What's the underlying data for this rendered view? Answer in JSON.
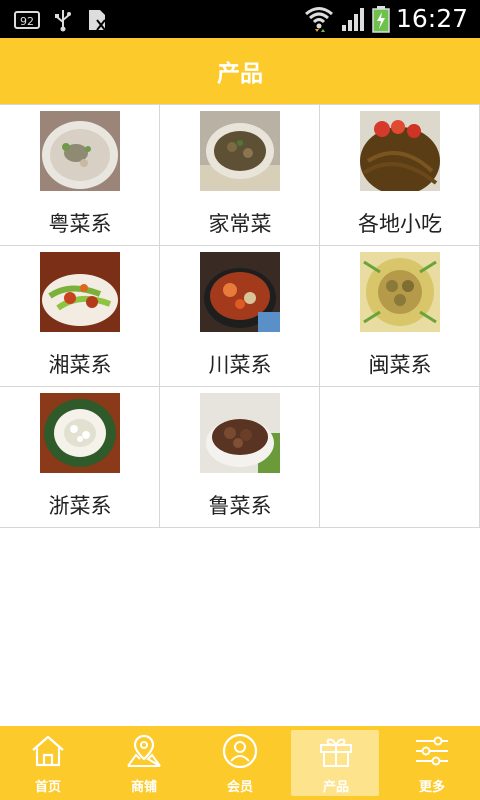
{
  "status_bar": {
    "time": "16:27",
    "icons": [
      "notification-92-icon",
      "usb-icon",
      "sim-icon",
      "wifi-icon",
      "signal-icon",
      "battery-charging-icon"
    ],
    "notification_number": "92"
  },
  "header": {
    "title": "产品"
  },
  "products": [
    {
      "label": "粤菜系",
      "icon": "cantonese-dish-photo"
    },
    {
      "label": "家常菜",
      "icon": "home-style-dish-photo"
    },
    {
      "label": "各地小吃",
      "icon": "local-snacks-photo"
    },
    {
      "label": "湘菜系",
      "icon": "hunan-dish-photo"
    },
    {
      "label": "川菜系",
      "icon": "sichuan-dish-photo"
    },
    {
      "label": "闽菜系",
      "icon": "fujian-dish-photo"
    },
    {
      "label": "浙菜系",
      "icon": "zhejiang-dish-photo"
    },
    {
      "label": "鲁菜系",
      "icon": "shandong-dish-photo"
    }
  ],
  "tab_bar": {
    "items": [
      {
        "label": "首页",
        "icon": "home-icon"
      },
      {
        "label": "商铺",
        "icon": "map-store-icon"
      },
      {
        "label": "会员",
        "icon": "member-icon"
      },
      {
        "label": "产品",
        "icon": "gift-icon",
        "active": true
      },
      {
        "label": "更多",
        "icon": "settings-sliders-icon"
      }
    ]
  },
  "colors": {
    "accent": "#fcca2b",
    "active_tab": "#fde48c",
    "status_bar": "#000000"
  }
}
